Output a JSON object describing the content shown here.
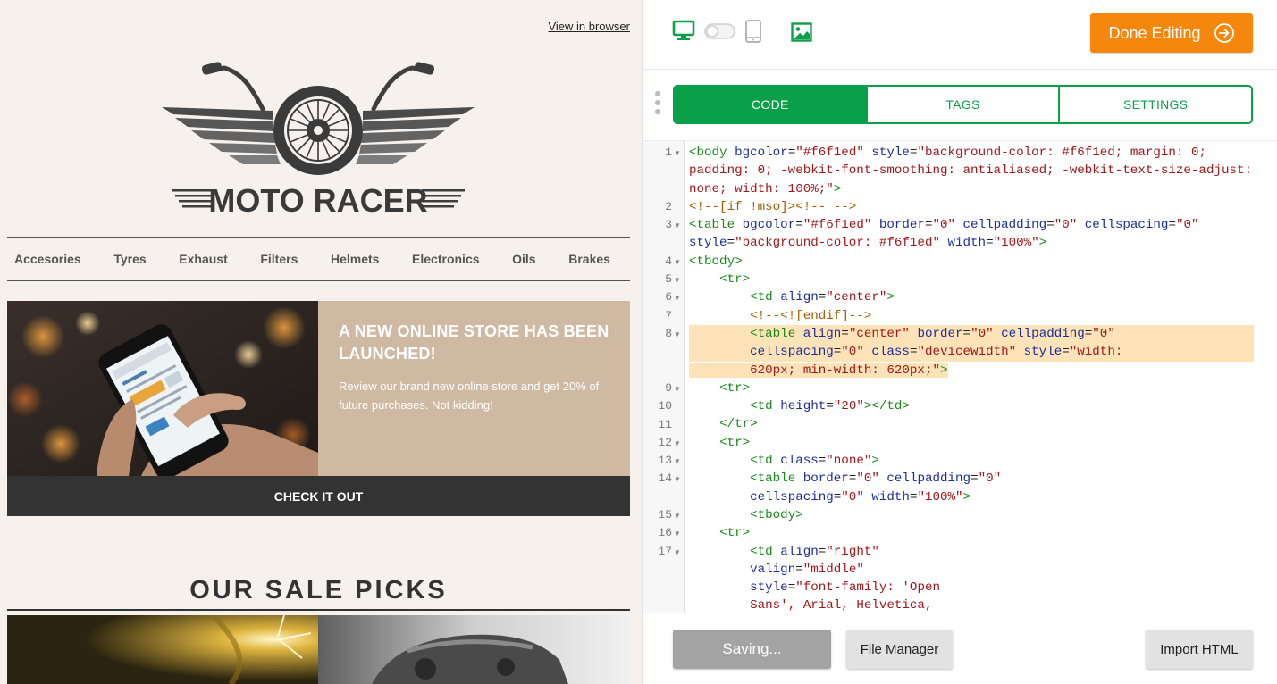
{
  "preview": {
    "view_in_browser": "View in browser",
    "brand_name": "MOTO RACER",
    "nav": [
      "Accesories",
      "Tyres",
      "Exhaust",
      "Filters",
      "Helmets",
      "Electronics",
      "Oils",
      "Brakes"
    ],
    "hero": {
      "title": "A NEW ONLINE STORE HAS BEEN LAUNCHED!",
      "body": "Review our brand new online store and get 20% of future purchases. Not kidding!",
      "cta": "CHECK IT OUT",
      "image": "hand-holding-phone-photo"
    },
    "sale_title": "OUR SALE PICKS",
    "colors": {
      "background": "#f6f1ed",
      "hero_panel": "#d0b9a3",
      "cta_bar": "#333333"
    }
  },
  "editor": {
    "toolbar": {
      "desktop_icon": "desktop-icon",
      "toggle": "view-toggle",
      "mobile_icon": "mobile-icon",
      "image_icon": "image-icon",
      "done_label": "Done Editing"
    },
    "tabs": [
      {
        "label": "CODE",
        "active": true
      },
      {
        "label": "TAGS",
        "active": false
      },
      {
        "label": "SETTINGS",
        "active": false
      }
    ],
    "line_numbers": [
      "1",
      "2",
      "3",
      "4",
      "5",
      "6",
      "7",
      "8",
      "9",
      "10",
      "11",
      "12",
      "13",
      "14",
      "15",
      "16",
      "17"
    ],
    "footer": {
      "saving_label": "Saving...",
      "file_manager_label": "File Manager",
      "import_label": "Import HTML"
    },
    "colors": {
      "accent_green": "#0aa04a",
      "done_orange": "#f5870c"
    }
  },
  "code_lines": [
    [
      [
        "t",
        "<body "
      ],
      [
        "a",
        "bgcolor"
      ],
      [
        "",
        "="
      ],
      [
        "v",
        "\"#f6f1ed\" "
      ],
      [
        "a",
        "style"
      ],
      [
        "",
        "="
      ],
      [
        "v",
        "\"background-color: #f6f1ed; margin: 0;"
      ]
    ],
    [
      [
        "v",
        "padding: 0; -webkit-font-smoothing: antialiased; -webkit-text-size-adjust:"
      ]
    ],
    [
      [
        "v",
        "none; width: 100%;\""
      ],
      [
        "t",
        ">"
      ]
    ],
    [
      [
        "c",
        "<!--[if !mso]><!-- -->"
      ]
    ],
    [
      [
        "t",
        "<table "
      ],
      [
        "a",
        "bgcolor"
      ],
      [
        "",
        "="
      ],
      [
        "v",
        "\"#f6f1ed\" "
      ],
      [
        "a",
        "border"
      ],
      [
        "",
        "="
      ],
      [
        "v",
        "\"0\" "
      ],
      [
        "a",
        "cellpadding"
      ],
      [
        "",
        "="
      ],
      [
        "v",
        "\"0\" "
      ],
      [
        "a",
        "cellspacing"
      ],
      [
        "",
        "="
      ],
      [
        "v",
        "\"0\""
      ]
    ],
    [
      [
        "a",
        "style"
      ],
      [
        "",
        "="
      ],
      [
        "v",
        "\"background-color: #f6f1ed\" "
      ],
      [
        "a",
        "width"
      ],
      [
        "",
        "="
      ],
      [
        "v",
        "\"100%\""
      ],
      [
        "t",
        ">"
      ]
    ],
    [
      [
        "t",
        "<tbody>"
      ]
    ],
    [
      [
        "",
        "    "
      ],
      [
        "t",
        "<tr>"
      ]
    ],
    [
      [
        "",
        "        "
      ],
      [
        "t",
        "<td "
      ],
      [
        "a",
        "align"
      ],
      [
        "",
        "="
      ],
      [
        "v",
        "\"center\""
      ],
      [
        "t",
        ">"
      ]
    ],
    [
      [
        "",
        "        "
      ],
      [
        "c",
        "<!--<![endif]-->"
      ]
    ],
    [
      [
        "",
        "        "
      ],
      [
        "t",
        "<table "
      ],
      [
        "a",
        "align"
      ],
      [
        "",
        "="
      ],
      [
        "v",
        "\"center\" "
      ],
      [
        "a",
        "border"
      ],
      [
        "",
        "="
      ],
      [
        "v",
        "\"0\" "
      ],
      [
        "a",
        "cellpadding"
      ],
      [
        "",
        "="
      ],
      [
        "v",
        "\"0\""
      ]
    ],
    [
      [
        "",
        "        "
      ],
      [
        "a",
        "cellspacing"
      ],
      [
        "",
        "="
      ],
      [
        "v",
        "\"0\" "
      ],
      [
        "a",
        "class"
      ],
      [
        "",
        "="
      ],
      [
        "v",
        "\"devicewidth\" "
      ],
      [
        "a",
        "style"
      ],
      [
        "",
        "="
      ],
      [
        "v",
        "\"width:"
      ]
    ],
    [
      [
        "",
        "        "
      ],
      [
        "v",
        "620px; min-width: 620px;\""
      ],
      [
        "t",
        ">"
      ]
    ],
    [
      [
        "",
        "    "
      ],
      [
        "t",
        "<tr>"
      ]
    ],
    [
      [
        "",
        "        "
      ],
      [
        "t",
        "<td "
      ],
      [
        "a",
        "height"
      ],
      [
        "",
        "="
      ],
      [
        "v",
        "\"20\""
      ],
      [
        "t",
        "></td>"
      ]
    ],
    [
      [
        "",
        "    "
      ],
      [
        "t",
        "</tr>"
      ]
    ],
    [
      [
        "",
        "    "
      ],
      [
        "t",
        "<tr>"
      ]
    ],
    [
      [
        "",
        "        "
      ],
      [
        "t",
        "<td "
      ],
      [
        "a",
        "class"
      ],
      [
        "",
        "="
      ],
      [
        "v",
        "\"none\""
      ],
      [
        "t",
        ">"
      ]
    ],
    [
      [
        "",
        "        "
      ],
      [
        "t",
        "<table "
      ],
      [
        "a",
        "border"
      ],
      [
        "",
        "="
      ],
      [
        "v",
        "\"0\" "
      ],
      [
        "a",
        "cellpadding"
      ],
      [
        "",
        "="
      ],
      [
        "v",
        "\"0\""
      ]
    ],
    [
      [
        "",
        "        "
      ],
      [
        "a",
        "cellspacing"
      ],
      [
        "",
        "="
      ],
      [
        "v",
        "\"0\" "
      ],
      [
        "a",
        "width"
      ],
      [
        "",
        "="
      ],
      [
        "v",
        "\"100%\""
      ],
      [
        "t",
        ">"
      ]
    ],
    [
      [
        "",
        "        "
      ],
      [
        "t",
        "<tbody>"
      ]
    ],
    [
      [
        "",
        "    "
      ],
      [
        "t",
        "<tr>"
      ]
    ],
    [
      [
        "",
        "        "
      ],
      [
        "t",
        "<td "
      ],
      [
        "a",
        "align"
      ],
      [
        "",
        "="
      ],
      [
        "v",
        "\"right\""
      ]
    ],
    [
      [
        "",
        "        "
      ],
      [
        "a",
        "valign"
      ],
      [
        "",
        "="
      ],
      [
        "v",
        "\"middle\""
      ]
    ],
    [
      [
        "",
        "        "
      ],
      [
        "a",
        "style"
      ],
      [
        "",
        "="
      ],
      [
        "v",
        "\"font-family: 'Open"
      ]
    ],
    [
      [
        "",
        "        "
      ],
      [
        "v",
        "Sans', Arial, Helvetica,"
      ]
    ]
  ]
}
